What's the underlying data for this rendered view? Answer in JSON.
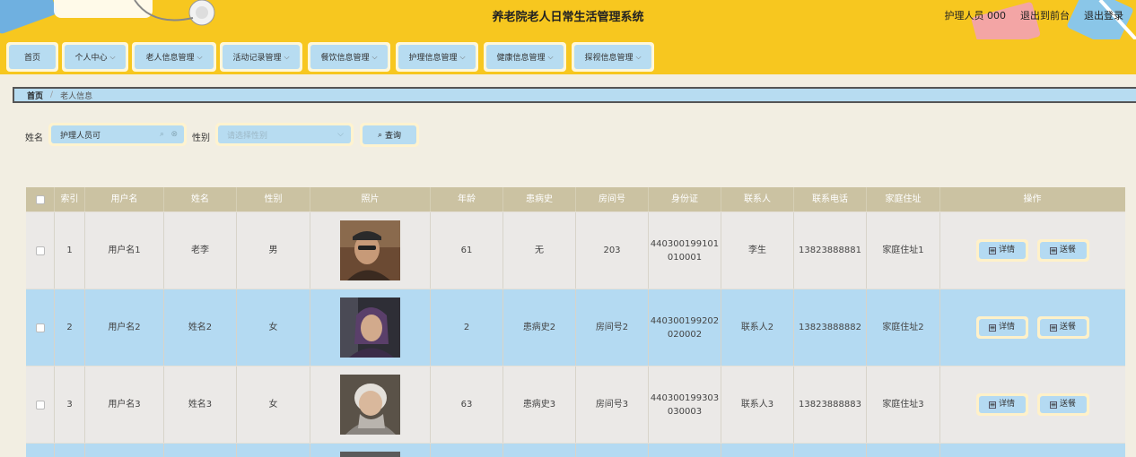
{
  "header": {
    "title": "养老院老人日常生活管理系统",
    "user": "护理人员 000",
    "to_front": "退出到前台",
    "logout": "退出登录"
  },
  "nav": [
    {
      "label": "首页",
      "caret": false
    },
    {
      "label": "个人中心",
      "caret": true
    },
    {
      "label": "老人信息管理",
      "caret": true
    },
    {
      "label": "活动记录管理",
      "caret": true
    },
    {
      "label": "餐饮信息管理",
      "caret": true
    },
    {
      "label": "护理信息管理",
      "caret": true
    },
    {
      "label": "健康信息管理",
      "caret": true
    },
    {
      "label": "探视信息管理",
      "caret": true
    }
  ],
  "breadcrumb": {
    "home": "首页",
    "separator": "/",
    "current": "老人信息"
  },
  "search": {
    "name_label": "姓名",
    "name_value": "护理人员可",
    "gender_label": "性别",
    "gender_placeholder": "请选择性别",
    "query_label": "查询"
  },
  "table": {
    "headers": [
      "索引",
      "用户名",
      "姓名",
      "性别",
      "照片",
      "年龄",
      "患病史",
      "房间号",
      "身份证",
      "联系人",
      "联系电话",
      "家庭住址",
      "操作"
    ],
    "rows": [
      {
        "index": "1",
        "username": "用户名1",
        "name": "老李",
        "gender": "男",
        "photo": "elderly-man-portrait",
        "age": "61",
        "history": "无",
        "room": "203",
        "id_line1": "440300199101",
        "id_line2": "010001",
        "contact": "李生",
        "phone": "13823888881",
        "address": "家庭住址1"
      },
      {
        "index": "2",
        "username": "用户名2",
        "name": "姓名2",
        "gender": "女",
        "photo": "elderly-woman-hood-portrait",
        "age": "2",
        "history": "患病史2",
        "room": "房间号2",
        "id_line1": "440300199202",
        "id_line2": "020002",
        "contact": "联系人2",
        "phone": "13823888882",
        "address": "家庭住址2"
      },
      {
        "index": "3",
        "username": "用户名3",
        "name": "姓名3",
        "gender": "女",
        "photo": "elderly-woman-smiling-portrait",
        "age": "63",
        "history": "患病史3",
        "room": "房间号3",
        "id_line1": "440300199303",
        "id_line2": "030003",
        "contact": "联系人3",
        "phone": "13823888883",
        "address": "家庭住址3"
      }
    ],
    "actions": {
      "detail": "详情",
      "meal": "送餐"
    }
  },
  "colors": {
    "header_bg": "#f7c71f",
    "nav_button": "#b7dcf1",
    "table_head": "#cbc2a2",
    "row_even": "#b4daf2",
    "row_odd": "#ebe9e7"
  }
}
